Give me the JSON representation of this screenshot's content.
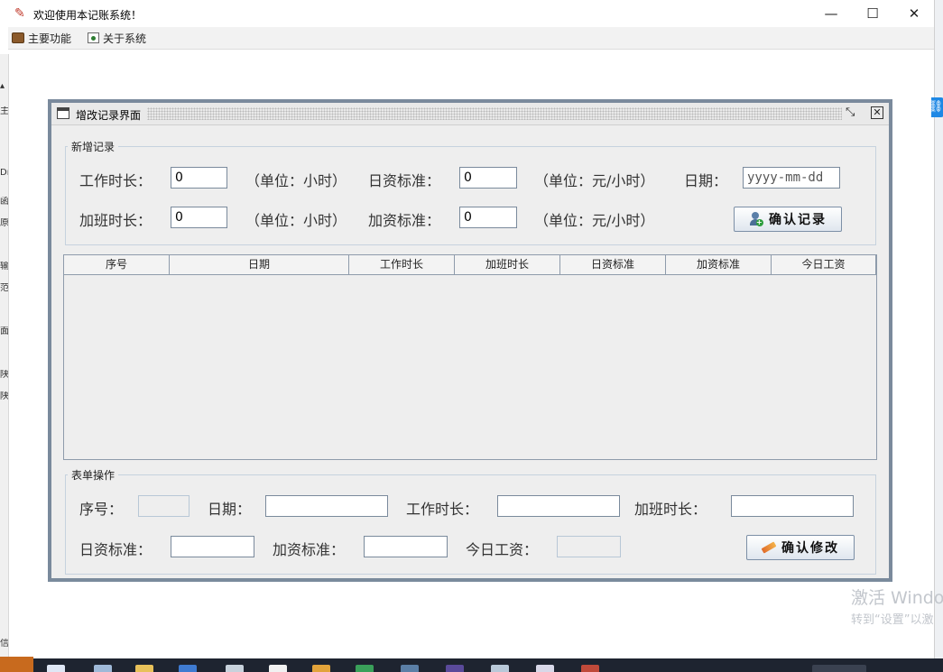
{
  "window": {
    "title": "欢迎使用本记账系统！",
    "minimize_glyph": "—",
    "maximize_glyph": "☐",
    "close_glyph": "✕"
  },
  "menu": {
    "items": [
      {
        "label": "主要功能",
        "icon": "briefcase-icon"
      },
      {
        "label": "关于系统",
        "icon": "info-card-icon"
      }
    ]
  },
  "internal_frame": {
    "title": "增改记录界面"
  },
  "add_group": {
    "title": "新增记录",
    "work_hours_label": "工作时长：",
    "work_hours_value": "0",
    "unit_hour_1": "（单位：小时）",
    "daily_rate_label": "日资标准：",
    "daily_rate_value": "0",
    "unit_rate_1": "（单位：元/小时）",
    "date_label": "日期：",
    "date_placeholder": "yyyy-mm-dd",
    "overtime_label": "加班时长：",
    "overtime_value": "0",
    "unit_hour_2": "（单位：小时）",
    "overtime_rate_label": "加资标准：",
    "overtime_rate_value": "0",
    "unit_rate_2": "（单位：元/小时）",
    "confirm_label": "确认记录"
  },
  "table": {
    "columns": [
      "序号",
      "日期",
      "工作时长",
      "加班时长",
      "日资标准",
      "加资标准",
      "今日工资"
    ],
    "rows": []
  },
  "edit_group": {
    "title": "表单操作",
    "id_label": "序号：",
    "date_label": "日期：",
    "work_hours_label": "工作时长：",
    "overtime_label": "加班时长：",
    "daily_rate_label": "日资标准：",
    "overtime_rate_label": "加资标准：",
    "today_wage_label": "今日工资：",
    "confirm_label": "确认修改"
  },
  "background": {
    "watermark_line1": "激活 Windo",
    "watermark_line2": "转到“设置”以激"
  },
  "colors": {
    "frame_border": "#7a8a9c",
    "panel_bg": "#eeeeee",
    "group_border": "#c6d2de"
  }
}
